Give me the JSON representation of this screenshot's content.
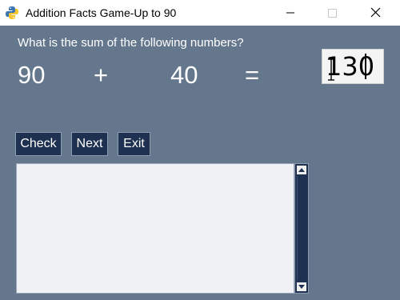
{
  "window": {
    "title": "Addition Facts Game-Up to 90",
    "minimize_icon": "minimize-icon",
    "maximize_icon": "maximize-icon",
    "close_icon": "close-icon",
    "app_icon": "python-icon"
  },
  "game": {
    "prompt": "What is the sum of the following numbers?",
    "number1": "90",
    "operator": "+",
    "number2": "40",
    "equals": "=",
    "answer": "130"
  },
  "buttons": {
    "check": "Check",
    "next": "Next",
    "exit": "Exit"
  },
  "output": {
    "text": ""
  },
  "colors": {
    "background": "#64778d",
    "button": "#1e3150",
    "text": "#ffffff"
  }
}
